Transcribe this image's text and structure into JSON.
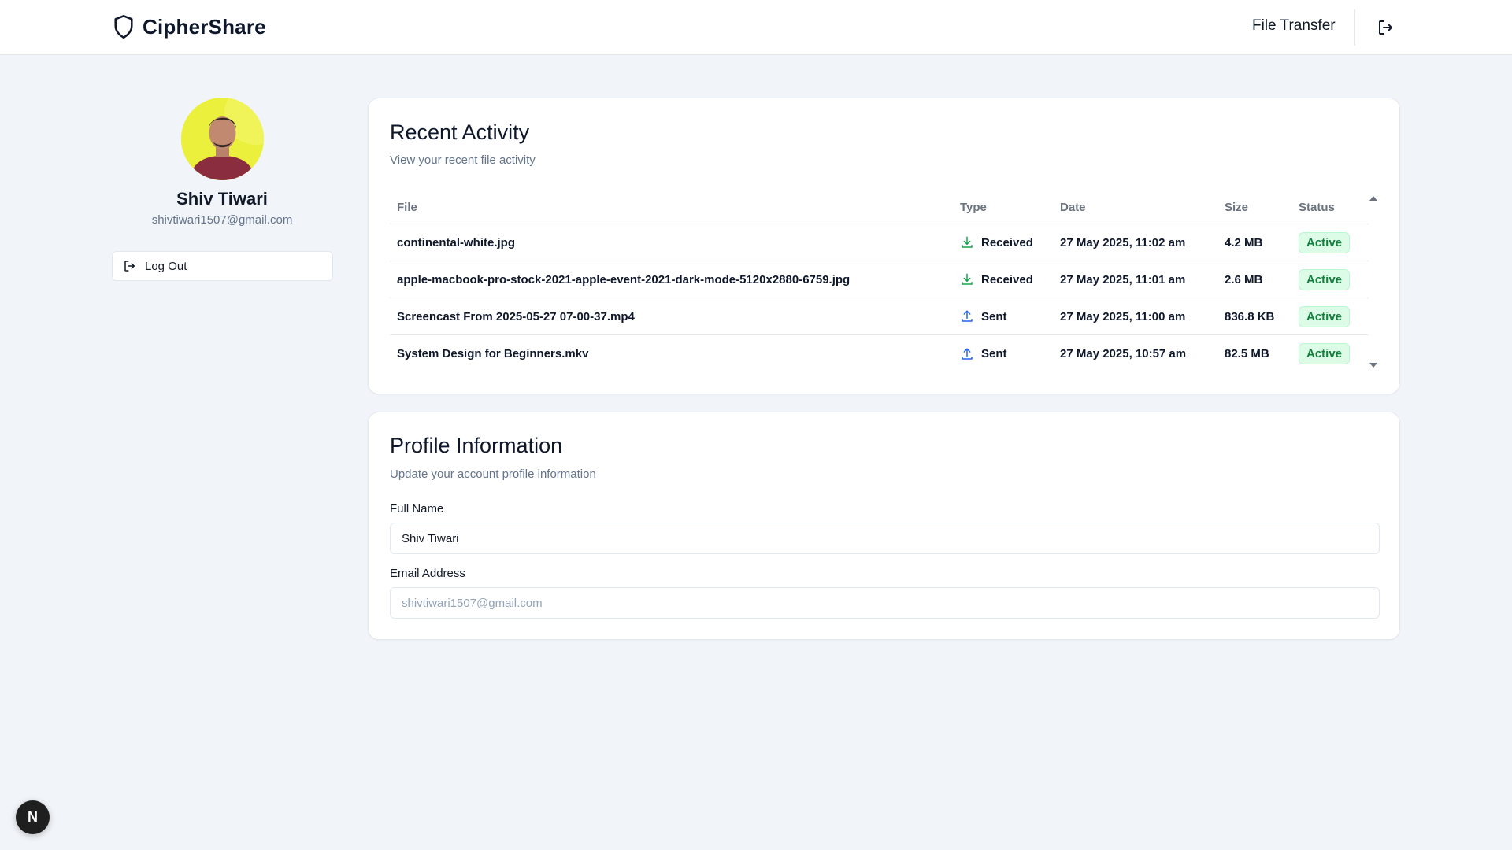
{
  "header": {
    "brand": "CipherShare",
    "nav_link": "File Transfer"
  },
  "sidebar": {
    "name": "Shiv Tiwari",
    "email": "shivtiwari1507@gmail.com",
    "logout_label": "Log Out"
  },
  "activity": {
    "title": "Recent Activity",
    "subtitle": "View your recent file activity",
    "columns": {
      "file": "File",
      "type": "Type",
      "date": "Date",
      "size": "Size",
      "status": "Status"
    },
    "rows": [
      {
        "file": "continental-white.jpg",
        "type": "Received",
        "type_icon": "download-icon",
        "date": "27 May 2025, 11:02 am",
        "size": "4.2 MB",
        "status": "Active"
      },
      {
        "file": "apple-macbook-pro-stock-2021-apple-event-2021-dark-mode-5120x2880-6759.jpg",
        "type": "Received",
        "type_icon": "download-icon",
        "date": "27 May 2025, 11:01 am",
        "size": "2.6 MB",
        "status": "Active"
      },
      {
        "file": "Screencast From 2025-05-27 07-00-37.mp4",
        "type": "Sent",
        "type_icon": "upload-icon",
        "date": "27 May 2025, 11:00 am",
        "size": "836.8 KB",
        "status": "Active"
      },
      {
        "file": "System Design for Beginners.mkv",
        "type": "Sent",
        "type_icon": "upload-icon",
        "date": "27 May 2025, 10:57 am",
        "size": "82.5 MB",
        "status": "Active"
      }
    ]
  },
  "profile": {
    "title": "Profile Information",
    "subtitle": "Update your account profile information",
    "full_name_label": "Full Name",
    "full_name_value": "Shiv Tiwari",
    "email_label": "Email Address",
    "email_value": "shivtiwari1507@gmail.com"
  },
  "fab_label": "N",
  "colors": {
    "received_icon": "#16a34a",
    "sent_icon": "#2563eb",
    "badge_bg": "#dcfce7",
    "badge_text": "#15803d",
    "background": "#f1f4f8"
  }
}
